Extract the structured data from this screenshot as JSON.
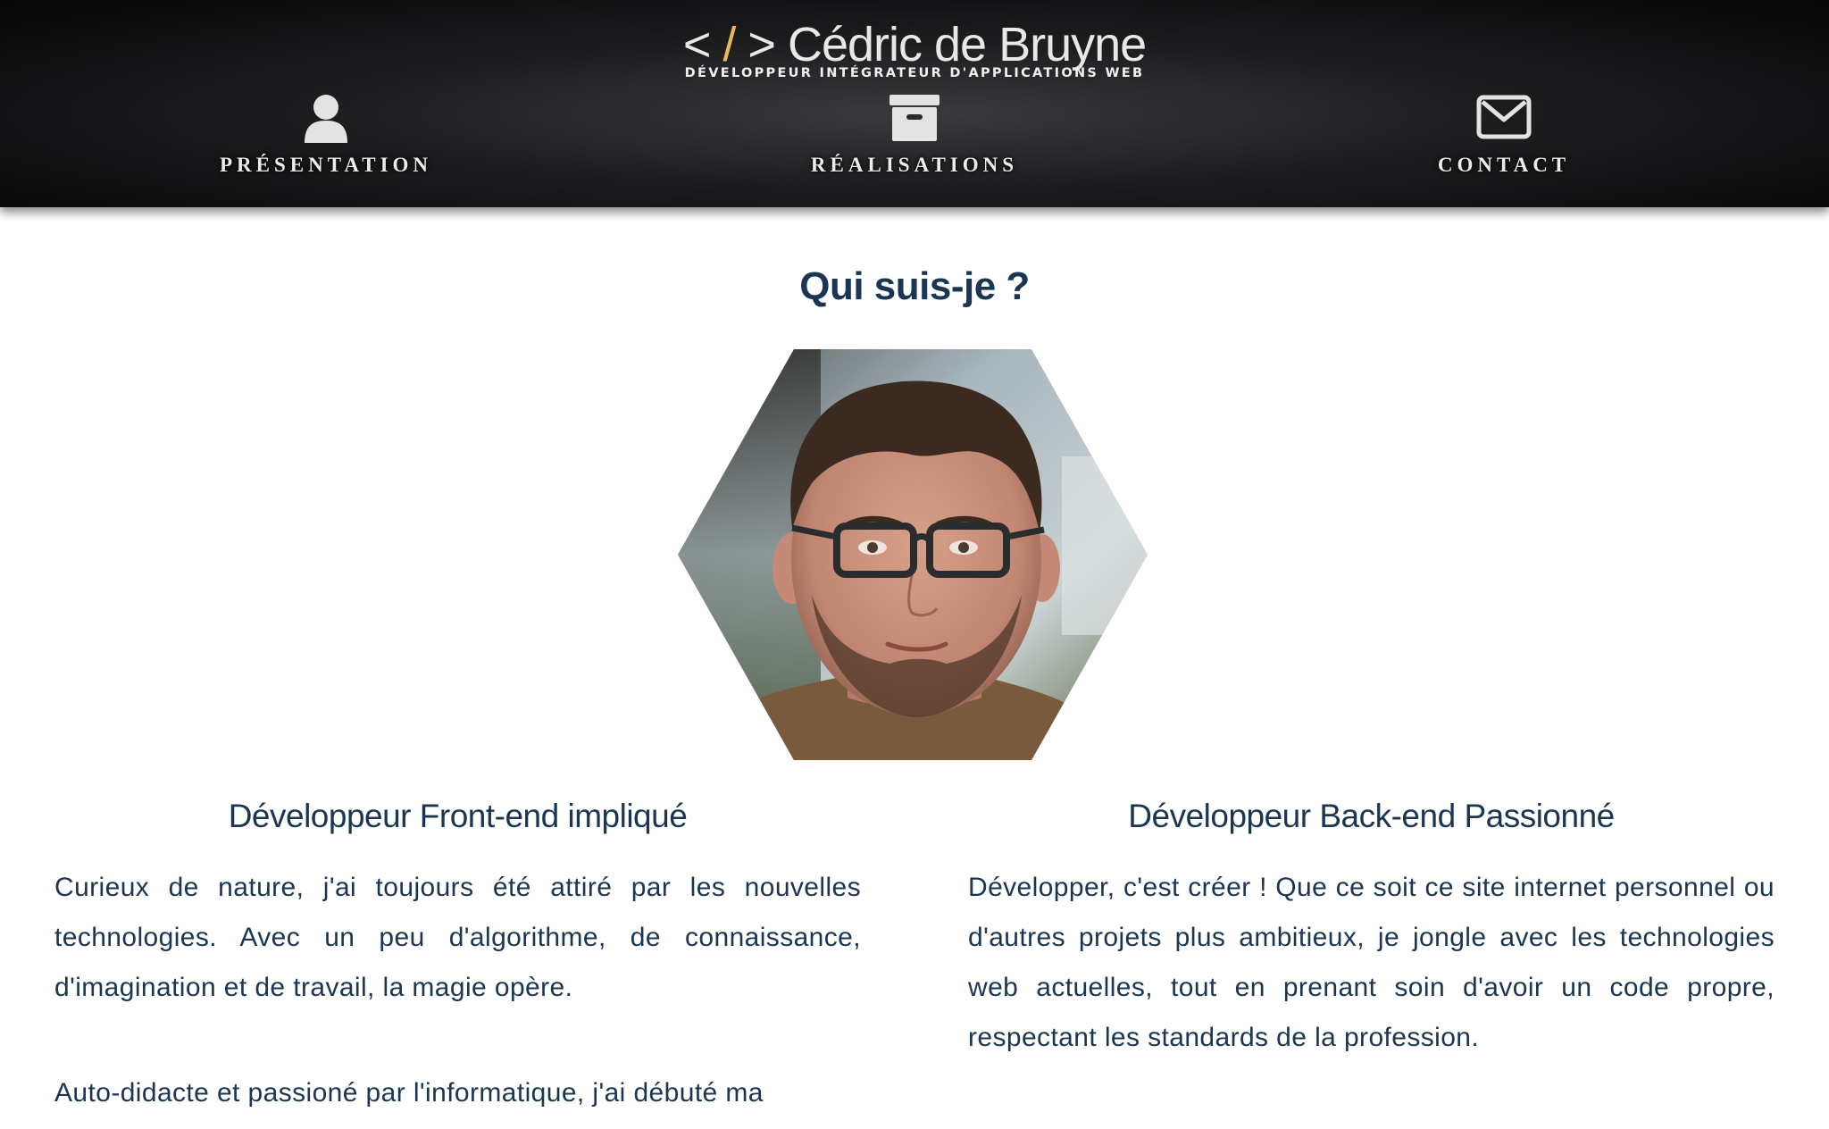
{
  "header": {
    "brand": {
      "prefix": "<",
      "slash": "/",
      "suffix": ">",
      "name": "Cédric de Bruyne",
      "tagline": "DÉVELOPPEUR INTÉGRATEUR D'APPLICATIONS WEB"
    },
    "nav": [
      {
        "label": "PRÉSENTATION",
        "icon": "user-icon"
      },
      {
        "label": "RÉALISATIONS",
        "icon": "archive-box-icon"
      },
      {
        "label": "CONTACT",
        "icon": "envelope-icon"
      }
    ]
  },
  "main": {
    "title": "Qui suis-je ?",
    "columns": [
      {
        "heading": "Développeur Front-end impliqué",
        "paragraphs": [
          "Curieux de nature, j'ai toujours été attiré par les nouvelles technologies. Avec un peu d'algorithme, de connaissance, d'imagination et de travail, la magie opère.",
          "Auto-didacte et passioné par l'informatique, j'ai débuté ma"
        ]
      },
      {
        "heading": "Développeur Back-end Passionné",
        "paragraphs": [
          "Développer, c'est créer ! Que ce soit ce site internet personnel ou d'autres projets plus ambitieux, je jongle avec les technologies web actuelles, tout en prenant soin d'avoir un code propre, respectant les standards de la profession."
        ]
      }
    ]
  },
  "colors": {
    "header_bg": "#1d1d20",
    "accent_slash": "#e8b957",
    "text_primary": "#1b3653",
    "nav_text": "#ececec"
  }
}
